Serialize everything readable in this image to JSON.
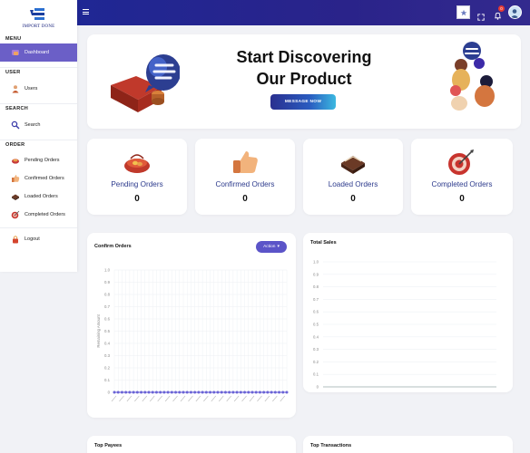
{
  "logo": {
    "text": "IMPORT DONE"
  },
  "sidebar": {
    "menu_title": "MENU",
    "user_title": "USER",
    "search_title": "SEARCH",
    "order_title": "ORDER",
    "items": [
      {
        "label": "Dashboard",
        "icon": "dashboard-icon"
      },
      {
        "label": "Users",
        "icon": "user-icon"
      },
      {
        "label": "Search",
        "icon": "search-icon"
      },
      {
        "label": "Pending Orders",
        "icon": "pending-orders-icon"
      },
      {
        "label": "Confirmed Orders",
        "icon": "confirmed-orders-icon"
      },
      {
        "label": "Loaded Orders",
        "icon": "loaded-orders-icon"
      },
      {
        "label": "Completed Orders",
        "icon": "completed-orders-icon"
      },
      {
        "label": "Logout",
        "icon": "logout-icon"
      }
    ]
  },
  "topbar": {
    "notification_count": "0"
  },
  "hero": {
    "title_line1": "Start Discovering",
    "title_line2": "Our Product",
    "button_label": "MESSAGE NOW"
  },
  "stats": [
    {
      "label": "Pending Orders",
      "value": "0",
      "icon": "wallet-icon"
    },
    {
      "label": "Confirmed Orders",
      "value": "0",
      "icon": "thumbs-up-icon"
    },
    {
      "label": "Loaded Orders",
      "value": "0",
      "icon": "wallet-icon"
    },
    {
      "label": "Completed Orders",
      "value": "0",
      "icon": "target-icon"
    }
  ],
  "confirm_orders": {
    "title": "Confirm Orders",
    "action_label": "Action",
    "y_axis_label": "Remaining Amount"
  },
  "total_sales": {
    "title": "Total Sales"
  },
  "top_payees": {
    "title": "Top Payees"
  },
  "top_transactions": {
    "title": "Top Transactions"
  },
  "colors": {
    "accent": "#5b54c8",
    "topbar": "#2a238a",
    "stat_label": "#2c3a8c"
  },
  "chart_data": [
    {
      "type": "line",
      "title": "Confirm Orders",
      "ylabel": "Remaining Amount",
      "xlabel": "",
      "yticks": [
        "1.0",
        "0.9",
        "0.8",
        "0.7",
        "0.6",
        "0.5",
        "0.4",
        "0.3",
        "0.2",
        "0.1",
        "0"
      ],
      "ylim": [
        0,
        1
      ],
      "series": [
        {
          "values": [
            0,
            0,
            0,
            0,
            0,
            0,
            0,
            0,
            0,
            0,
            0,
            0,
            0,
            0,
            0,
            0,
            0,
            0,
            0,
            0,
            0,
            0,
            0,
            0,
            0,
            0,
            0,
            0,
            0,
            0,
            0,
            0,
            0,
            0,
            0,
            0,
            0,
            0,
            0,
            0,
            0,
            0,
            0,
            0,
            0,
            0
          ]
        }
      ],
      "grid": true
    },
    {
      "type": "line",
      "title": "Total Sales",
      "yticks": [
        "1.0",
        "0.9",
        "0.8",
        "0.7",
        "0.6",
        "0.5",
        "0.4",
        "0.3",
        "0.2",
        "0.1",
        "0"
      ],
      "ylim": [
        0,
        1
      ],
      "series": [],
      "grid": true
    }
  ]
}
